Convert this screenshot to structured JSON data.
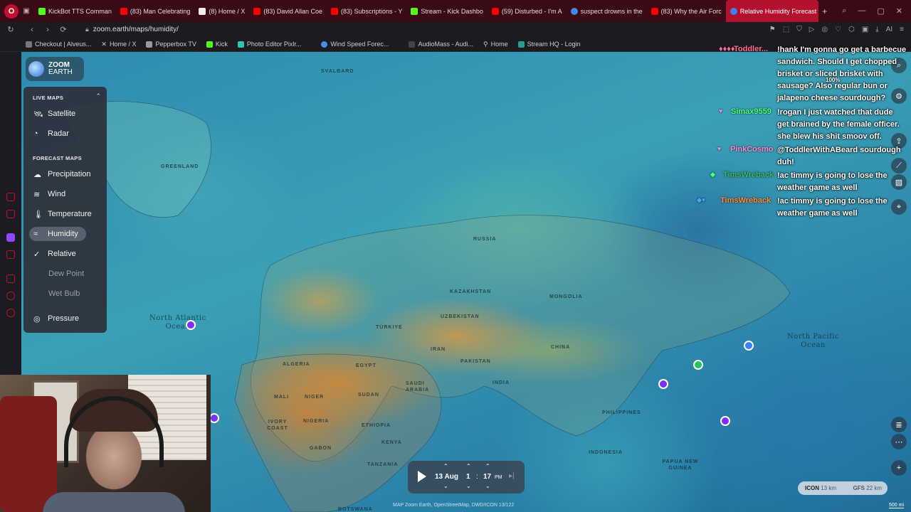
{
  "browser": {
    "tabs": [
      {
        "label": "KickBot TTS Comman",
        "color": "#53fc18"
      },
      {
        "label": "(83) Man Celebrating",
        "color": "#ff0000"
      },
      {
        "label": "(8) Home / X",
        "color": "#ffffff"
      },
      {
        "label": "(83) David Allan Coe",
        "color": "#ff0000"
      },
      {
        "label": "(83) Subscriptions - Y",
        "color": "#ff0000"
      },
      {
        "label": "Stream - Kick Dashbo",
        "color": "#53fc18"
      },
      {
        "label": "(59) Disturbed - I'm A",
        "color": "#ff0000"
      },
      {
        "label": "suspect drowns in the",
        "color": "#4285f4"
      },
      {
        "label": "(83) Why the Air Forc",
        "color": "#ff0000"
      },
      {
        "label": "Relative Humidity Forecast",
        "color": "#3b82f6"
      }
    ],
    "new_tab": "+",
    "url": "zoom.earth/maps/humidity/",
    "bookmarks": [
      {
        "label": "Checkout | Alveus...",
        "color": "#777777"
      },
      {
        "label": "Home / X",
        "color": "#ffffff"
      },
      {
        "label": "Pepperbox TV",
        "color": "#999999"
      },
      {
        "label": "Kick",
        "color": "#53fc18"
      },
      {
        "label": "Photo Editor Pixlr...",
        "color": "#2ec4b6"
      },
      {
        "label": "Wind Speed Forec...",
        "color": "#4a90e2"
      },
      {
        "label": "AudioMass - Audi...",
        "color": "#444444"
      },
      {
        "label": "Home",
        "color": "#cccccc"
      },
      {
        "label": "Stream HQ - Login",
        "color": "#2a9d8f"
      }
    ]
  },
  "logo": {
    "line1": "ZOOM",
    "line2": "EARTH"
  },
  "menu": {
    "live_title": "LIVE MAPS",
    "live_items": [
      "Satellite",
      "Radar"
    ],
    "forecast_title": "FORECAST MAPS",
    "forecast_items": [
      "Precipitation",
      "Wind",
      "Temperature",
      "Humidity"
    ],
    "humidity_sub": [
      "Relative",
      "Dew Point",
      "Wet Bulb"
    ],
    "pressure": "Pressure"
  },
  "map": {
    "places": [
      "SVALBARD",
      "GREENLAND",
      "RUSSIA",
      "KAZAKHSTAN",
      "MONGOLIA",
      "UZBEKISTAN",
      "TÜRKIYE",
      "IRAN",
      "CHINA",
      "PAKISTAN",
      "ALGERIA",
      "EGYPT",
      "SAUDI ARABIA",
      "INDIA",
      "MALI",
      "NIGER",
      "SUDAN",
      "IVORY COAST",
      "NIGERIA",
      "ETHIOPIA",
      "GABON",
      "KENYA",
      "TANZANIA",
      "PHILIPPINES",
      "INDONESIA",
      "PAPUA NEW GUINEA",
      "BOTSWANA"
    ],
    "north_atlantic": [
      "North Atlantic",
      "Ocean"
    ],
    "north_pacific": [
      "North Pacific",
      "Ocean"
    ],
    "markers": [
      "#7b2ff7",
      "#7b2ff7",
      "#7b2ff7",
      "#7b2ff7",
      "#22c55e",
      "#3b82f6"
    ]
  },
  "chat": {
    "messages": [
      {
        "user": "Toddler...",
        "color": "#ff6b9a",
        "text": "!hank I'm gonna go get a barbecue sandwich. Should I get chopped brisket or sliced brisket with sausage? Also regular bun or jalapeno cheese sourdough?"
      },
      {
        "user": "Simax9559",
        "color": "#4cff7a",
        "text": "!rogan I just watched that dude get brained by the female officer. she blew his shit smoov off."
      },
      {
        "user": "PinkCosmo",
        "color": "#ff8ad8",
        "text": "@ToddlerWithABeard sourdough duh!"
      },
      {
        "user": "TimsWreback",
        "color": "#3dba6a",
        "text": "!ac timmy is going to lose the weather game as well"
      },
      {
        "user": "TimsWreback",
        "color": "#ff8c3a",
        "text": "!ac timmy is going to lose the weather game as well"
      }
    ],
    "zoom_label": "100%"
  },
  "timeline": {
    "date": "13 Aug",
    "hour": "1",
    "minute": "17",
    "ampm": "PM"
  },
  "models": [
    {
      "name": "ICON",
      "res": "13 km"
    },
    {
      "name": "GFS",
      "res": "22 km"
    }
  ],
  "attribution": "MAP Zoom Earth, OpenStreetMap, DWD/ICON 13/122",
  "scale": "500 mi"
}
